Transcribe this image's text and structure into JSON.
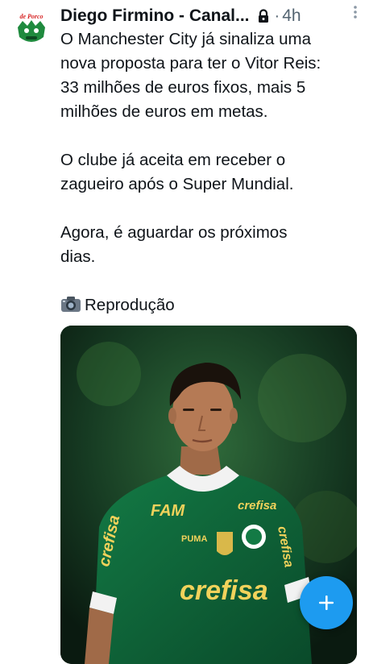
{
  "tweet": {
    "author_name": "Diego Firmino - Canal...",
    "avatar_text": "de Porco",
    "dot": "·",
    "time": "4h",
    "paragraphs": [
      [
        "O Manchester City já sinaliza uma",
        "nova proposta para ter o Vitor Reis:",
        "33 milhões de euros fixos, mais 5",
        "milhões de euros em metas."
      ],
      [
        "O clube já aceita em receber o",
        "zagueiro após o Super Mundial."
      ],
      [
        "Agora, é aguardar os próximos",
        "dias."
      ]
    ],
    "credit": "Reprodução"
  },
  "photo": {
    "sponsor_text": "crefisa",
    "chest_left_text": "FAM",
    "chest_right_text": "crefisa",
    "brand_text": "PUMA"
  },
  "fab": {
    "icon": "plus-icon"
  },
  "colors": {
    "accent": "#1d9bf0",
    "text": "#0f1419",
    "secondary": "#536471",
    "kit_green": "#0e5a34"
  }
}
